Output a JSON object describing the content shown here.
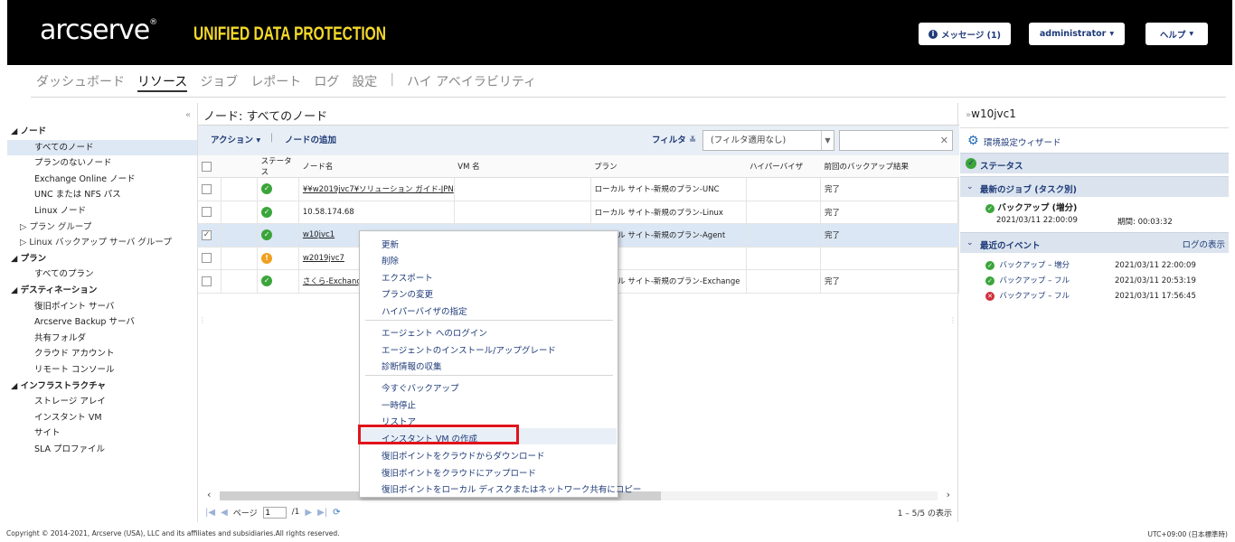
{
  "header": {
    "logo": "arcserve",
    "logo_mark": "®",
    "product": "UNIFIED DATA PROTECTION",
    "messages_button": "メッセージ (1)",
    "user_button": "administrator",
    "help_button": "ヘルプ"
  },
  "nav": {
    "tabs": [
      "ダッシュボード",
      "リソース",
      "ジョブ",
      "レポート",
      "ログ",
      "設定",
      "ハイ アベイラビリティ"
    ],
    "active": "リソース",
    "separator": "|"
  },
  "tree": {
    "sections": [
      {
        "label": "ノード",
        "items": [
          "すべてのノード",
          "プランのないノード",
          "Exchange Online ノード",
          "UNC または NFS パス",
          "Linux ノード"
        ],
        "subs": [
          "プラン グループ",
          "Linux バックアップ サーバ グループ"
        ]
      },
      {
        "label": "プラン",
        "items": [
          "すべてのプラン"
        ],
        "subs": []
      },
      {
        "label": "デスティネーション",
        "items": [
          "復旧ポイント サーバ",
          "Arcserve Backup サーバ",
          "共有フォルダ",
          "クラウド アカウント",
          "リモート コンソール"
        ],
        "subs": []
      },
      {
        "label": "インフラストラクチャ",
        "items": [
          "ストレージ アレイ",
          "インスタント VM",
          "サイト",
          "SLA プロファイル"
        ],
        "subs": []
      }
    ]
  },
  "center": {
    "breadcrumb": "ノード: すべてのノード",
    "toolbar": {
      "action": "アクション",
      "add_node": "ノードの追加",
      "filter": "フィルタ",
      "filter_value": "(フィルタ適用なし)"
    },
    "columns": [
      "ステータス",
      "ノード名",
      "VM 名",
      "プラン",
      "ハイパーバイザ",
      "前回のバックアップ結果"
    ],
    "rows": [
      {
        "status": "ok",
        "node": "¥¥w2019jvc7¥ソリューション ガイド-JPN",
        "vm": "",
        "plan": "ローカル サイト-新規のプラン-UNC",
        "hv": "",
        "result": "完了",
        "checked": false
      },
      {
        "status": "ok",
        "node": "10.58.174.68",
        "vm": "",
        "plan": "ローカル サイト-新規のプラン-Linux",
        "hv": "",
        "result": "完了",
        "checked": false
      },
      {
        "status": "ok",
        "node": "w10jvc1",
        "vm": "",
        "plan": "ローカル サイト-新規のプラン-Agent",
        "hv": "",
        "result": "完了",
        "checked": true
      },
      {
        "status": "warn",
        "node": "w2019jvc7",
        "vm": "",
        "plan": "",
        "hv": "",
        "result": "",
        "checked": false
      },
      {
        "status": "ok",
        "node": "さくら-Exchange",
        "vm": "",
        "plan": "ローカル サイト-新規のプラン-Exchange",
        "hv": "",
        "result": "完了",
        "checked": false
      }
    ],
    "pager": {
      "page_label": "ページ",
      "page": "1",
      "of": "/1",
      "count": "1 – 5/5 の表示"
    }
  },
  "context_menu": {
    "groups": [
      [
        "更新",
        "削除",
        "エクスポート",
        "プランの変更",
        "ハイパーバイザの指定"
      ],
      [
        "エージェント へのログイン",
        "エージェントのインストール/アップグレード",
        "診断情報の収集"
      ],
      [
        "今すぐバックアップ",
        "一時停止",
        "リストア",
        "インスタント VM の作成",
        "復旧ポイントをクラウドからダウンロード",
        "復旧ポイントをクラウドにアップロード",
        "復旧ポイントをローカル ディスクまたはネットワーク共有にコピー"
      ]
    ],
    "highlighted": "インスタント VM の作成"
  },
  "right": {
    "title": "w10jvc1",
    "wizard": "環境設定ウィザード",
    "status_label": "ステータス",
    "latest_jobs_label": "最新のジョブ (タスク別)",
    "job": {
      "name": "バックアップ (増分)",
      "time": "2021/03/11 22:00:09",
      "duration": "期間: 00:03:32"
    },
    "events_label": "最近のイベント",
    "show_log": "ログの表示",
    "events": [
      {
        "status": "ok",
        "name": "バックアップ – 増分",
        "time": "2021/03/11 22:00:09"
      },
      {
        "status": "ok",
        "name": "バックアップ – フル",
        "time": "2021/03/11 20:53:19"
      },
      {
        "status": "error",
        "name": "バックアップ – フル",
        "time": "2021/03/11 17:56:45"
      }
    ]
  },
  "footer": {
    "copyright": "Copyright © 2014-2021, Arcserve (USA), LLC and its affiliates and subsidiaries.All rights reserved.",
    "timezone": "UTC+09:00 (日本標準時)"
  },
  "colors": {
    "accent": "#1e3a78",
    "brand_yellow": "#f4d92a",
    "highlight_box": "#e1131b"
  }
}
